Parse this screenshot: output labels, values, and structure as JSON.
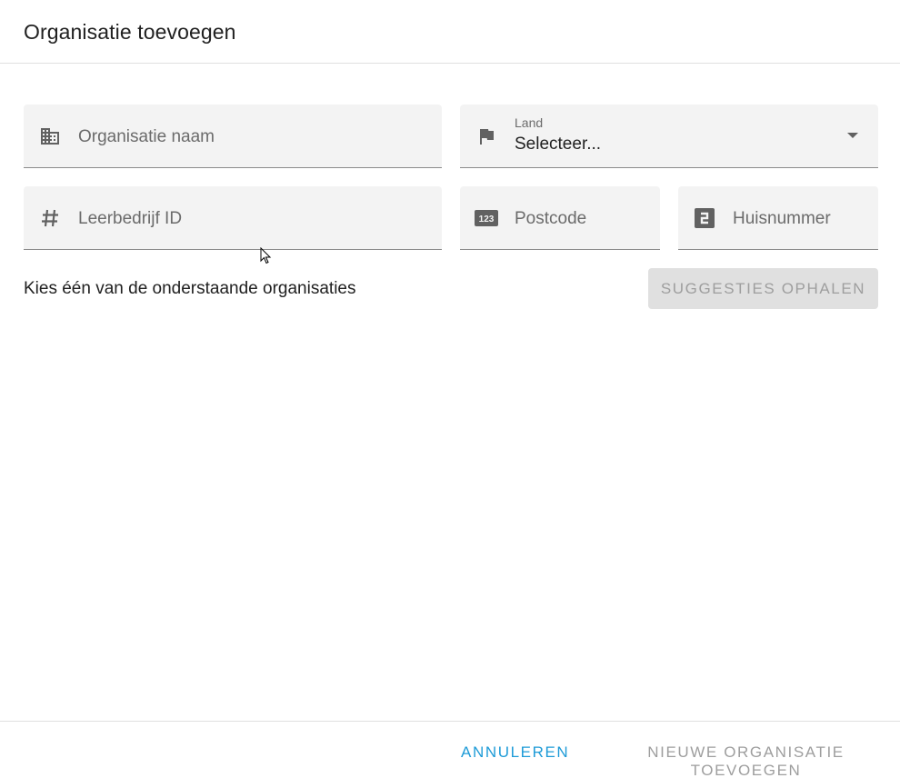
{
  "dialog": {
    "title": "Organisatie toevoegen"
  },
  "form": {
    "organisation_name": {
      "placeholder": "Organisatie naam",
      "icon": "domain-icon"
    },
    "country": {
      "label": "Land",
      "value": "Selecteer...",
      "icon": "flag-icon"
    },
    "leerbedrijf_id": {
      "placeholder": "Leerbedrijf ID",
      "icon": "hash-icon"
    },
    "postcode": {
      "placeholder": "Postcode",
      "icon": "numeric-123-icon"
    },
    "huisnummer": {
      "placeholder": "Huisnummer",
      "icon": "numeric-2-box-icon"
    }
  },
  "suggestions": {
    "hint": "Kies één van de onderstaande organisaties",
    "fetch_button": "SUGGESTIES OPHALEN"
  },
  "footer": {
    "cancel": "ANNULEREN",
    "add_new": "NIEUWE ORGANISATIE TOEVOEGEN"
  },
  "colors": {
    "accent": "#1e9bd7",
    "field_bg": "#f3f3f3",
    "disabled_text": "#9e9e9e"
  }
}
